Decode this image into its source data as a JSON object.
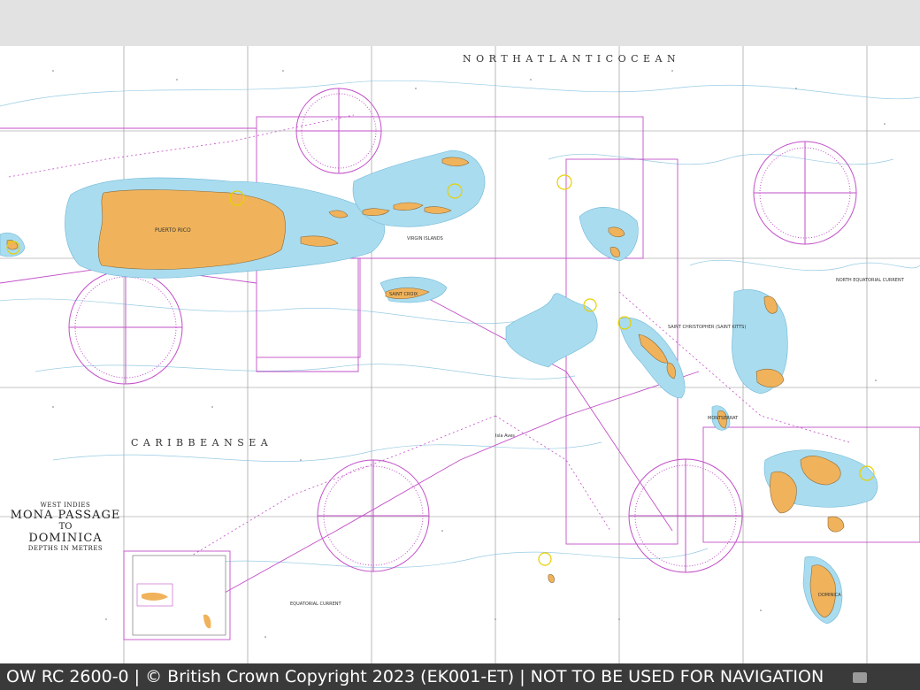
{
  "footer": {
    "text": "OW RC 2600-0 | © British Crown Copyright 2023 (EK001-ET) | NOT TO BE USED FOR NAVIGATION"
  },
  "chart_title": {
    "region": "WEST INDIES",
    "line1": "MONA PASSAGE",
    "line2": "TO",
    "line3": "DOMINICA",
    "depths": "DEPTHS IN METRES"
  },
  "sea_labels": {
    "north_atlantic": "N O R T H   A T L A N T I C   O C E A N",
    "caribbean": "C A R I B B E A N   S E A"
  },
  "place_labels": {
    "puerto_rico": "PUERTO RICO",
    "virgin_islands": "VIRGIN ISLANDS",
    "st_croix": "SAINT CROIX",
    "dominica": "DOMINICA",
    "montserrat": "MONTSERRAT",
    "st_kitts": "SAINT CHRISTOPHER (SAINT KITTS)",
    "aves": "Isla Aves",
    "equatorial_current": "EQUATORIAL CURRENT",
    "north_equatorial_current": "NORTH EQUATORIAL CURRENT"
  },
  "colors": {
    "land": "#f0b35b",
    "shallow": "#a9dcef",
    "magenta": "#c24fc8",
    "grid": "#8c8c8c",
    "contour": "#7fbfdc",
    "footer_bg": "#3a3a3a",
    "top_bar": "#e2e2e2"
  },
  "icons": {
    "compass_rose": "compass-rose-icon",
    "scroll": "scroll-thumb"
  }
}
